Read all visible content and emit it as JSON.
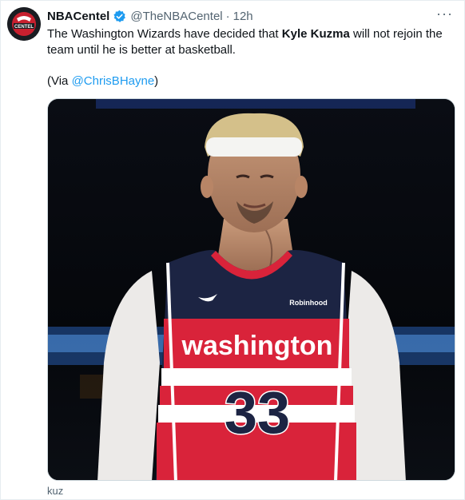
{
  "tweet": {
    "author": {
      "display_name": "NBACentel",
      "handle": "@TheNBACentel",
      "avatar_text": "CENTEL"
    },
    "separator": "·",
    "time": "12h",
    "more_label": "···",
    "text_before": "The Washington Wizards have decided that ",
    "text_bold": "Kyle Kuzma",
    "text_after": " will not rejoin the team until he is better at basketball.",
    "via_prefix": "(Via ",
    "via_mention": "@ChrisBHayne",
    "via_suffix": ")",
    "media": {
      "jersey_wordmark": "washington",
      "jersey_number": "33",
      "jersey_sponsor": "Robinhood"
    },
    "caption": "kuz"
  },
  "colors": {
    "verified": "#1d9bf0",
    "mention": "#1d9bf0",
    "jersey_red": "#d9233a",
    "jersey_navy": "#1c2443"
  }
}
